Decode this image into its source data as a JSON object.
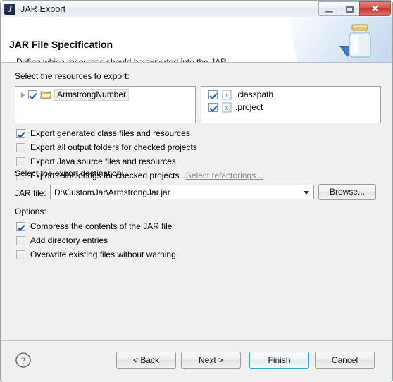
{
  "window": {
    "title": "JAR Export",
    "icon": "jar-export-app-icon",
    "controls": {
      "minimize": "minimize-icon",
      "maximize": "maximize-icon",
      "close": "✕"
    }
  },
  "header": {
    "title": "JAR File Specification",
    "description": "Define which resources should be exported into the JAR.",
    "icon": "jar-illustration-icon"
  },
  "resources": {
    "label": "Select the resources to export:",
    "tree": [
      {
        "label": "ArmstrongNumber",
        "checked": true,
        "expander": "chevron-right-icon",
        "icon": "java-project-folder-icon",
        "selected": true
      }
    ],
    "files": [
      {
        "label": ".classpath",
        "checked": true,
        "icon": "xml-file-icon"
      },
      {
        "label": ".project",
        "checked": true,
        "icon": "xml-file-icon"
      }
    ]
  },
  "export_options": [
    {
      "label": "Export generated class files and resources",
      "checked": true
    },
    {
      "label": "Export all output folders for checked projects",
      "checked": false
    },
    {
      "label": "Export Java source files and resources",
      "checked": false
    },
    {
      "label": "Export refactorings for checked projects.",
      "checked": false,
      "link": "Select refactorings..."
    }
  ],
  "destination": {
    "label": "Select the export destination:",
    "jar_file_label": "JAR file:",
    "jar_file_value": "D:\\CustomJar\\ArmstrongJar.jar",
    "browse_label": "Browse..."
  },
  "options": {
    "label": "Options:",
    "items": [
      {
        "label": "Compress the contents of the JAR file",
        "checked": true
      },
      {
        "label": "Add directory entries",
        "checked": false
      },
      {
        "label": "Overwrite existing files without warning",
        "checked": false
      }
    ]
  },
  "footer": {
    "help_icon": "help-question-icon",
    "back_label": "< Back",
    "next_label": "Next >",
    "finish_label": "Finish",
    "cancel_label": "Cancel"
  },
  "colors": {
    "accent": "#3c9fd4",
    "close_button": "#c23a30",
    "dialog_background": "#f0f0f0",
    "panel_background": "#ffffff",
    "link_disabled": "#8b8b8b"
  }
}
